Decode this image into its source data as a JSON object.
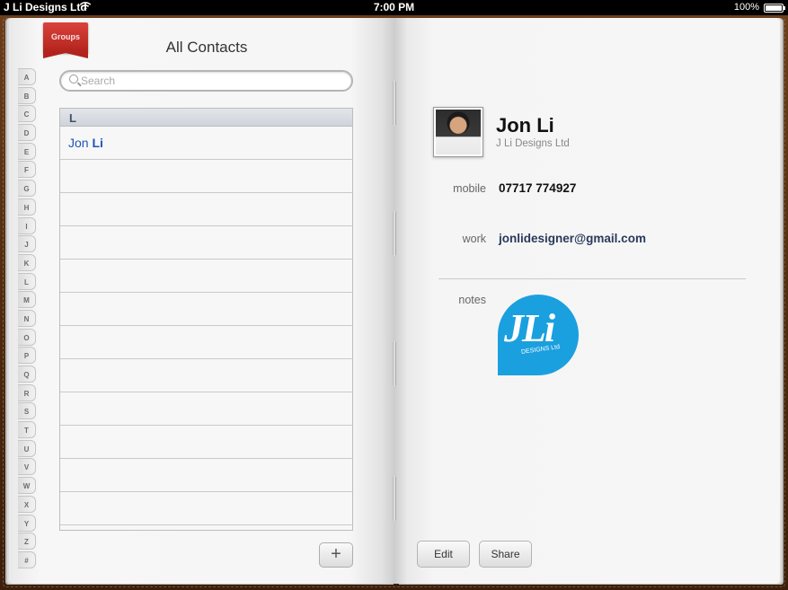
{
  "status_bar": {
    "carrier": "J Li Designs Ltd",
    "time": "7:00 PM",
    "battery": "100%"
  },
  "left_page": {
    "groups_label": "Groups",
    "title": "All Contacts",
    "search_placeholder": "Search",
    "index_tabs": [
      "A",
      "B",
      "C",
      "D",
      "E",
      "F",
      "G",
      "H",
      "I",
      "J",
      "K",
      "L",
      "M",
      "N",
      "O",
      "P",
      "Q",
      "R",
      "S",
      "T",
      "U",
      "V",
      "W",
      "X",
      "Y",
      "Z",
      "#"
    ],
    "sections": [
      {
        "header": "L",
        "contacts": [
          {
            "first": "Jon",
            "last": "Li"
          }
        ]
      }
    ],
    "add_label": "+"
  },
  "right_page": {
    "contact": {
      "name": "Jon Li",
      "company": "J Li Designs Ltd"
    },
    "fields": {
      "mobile_label": "mobile",
      "mobile_value": "07717 774927",
      "work_label": "work",
      "work_value": "jonlidesigner@gmail.com",
      "notes_label": "notes"
    },
    "logo": {
      "big": "JLi",
      "small": "DESIGNS Ltd",
      "color": "#1aa0de"
    },
    "buttons": {
      "edit": "Edit",
      "share": "Share"
    }
  }
}
